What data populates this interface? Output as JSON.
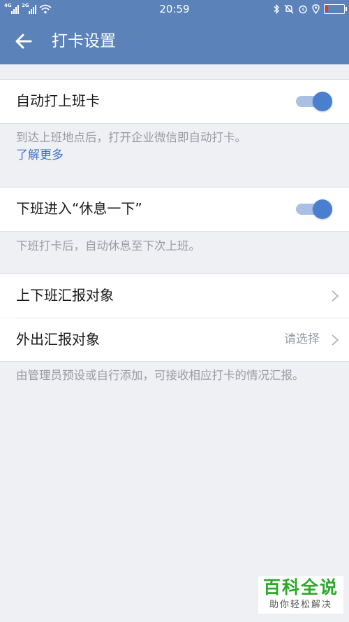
{
  "status_bar": {
    "time": "20:59",
    "network_1": "4G",
    "network_2": "2G",
    "battery_level": 0.15,
    "icons": [
      "signal-icon",
      "signal-icon",
      "wifi-icon",
      "bluetooth-icon",
      "mute-icon",
      "alarm-icon",
      "location-icon",
      "battery-icon"
    ]
  },
  "header": {
    "back_icon": "arrow-left-icon",
    "title": "打卡设置"
  },
  "auto_clock_in": {
    "label": "自动打上班卡",
    "enabled": true,
    "description": "到达上班地点后，打开企业微信即自动打卡。",
    "link": "了解更多"
  },
  "rest_after_work": {
    "label": "下班进入“休息一下”",
    "enabled": true,
    "description": "下班打卡后，自动休息至下次上班。"
  },
  "report": {
    "commute_label": "上下班汇报对象",
    "outside_label": "外出汇报对象",
    "outside_value": "请选择",
    "description": "由管理员预设或自行添加，可接收相应打卡的情况汇报。"
  },
  "watermark": {
    "title": "百科全说",
    "subtitle": "助你轻松解决"
  },
  "colors": {
    "header_bg": "#5b82b9",
    "toggle_on": "#4a7fcf",
    "link": "#3f73c0",
    "page_bg": "#eff0f4"
  }
}
